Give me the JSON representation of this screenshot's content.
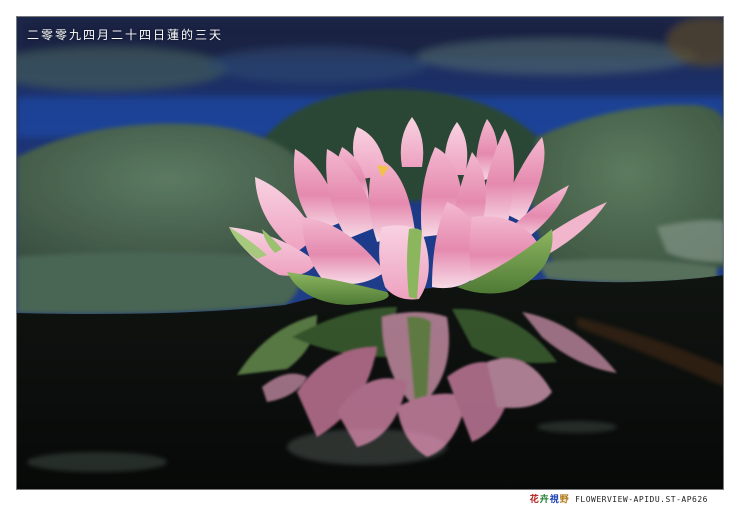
{
  "caption": "二零零九四月二十四日蓮的三天",
  "watermark": {
    "chars": [
      "花",
      "卉",
      "視",
      "野"
    ],
    "text": "FLOWERVIEW-APIDU.ST-AP626"
  },
  "colors": {
    "frame": "#ffffff",
    "water": "#0c0f0d",
    "background_blue": "#1a3a8a",
    "leaf_green": "#3f5a44",
    "petal_pink": "#e78ab0",
    "petal_light": "#f6d3e1",
    "petal_green": "#7fa75a"
  }
}
